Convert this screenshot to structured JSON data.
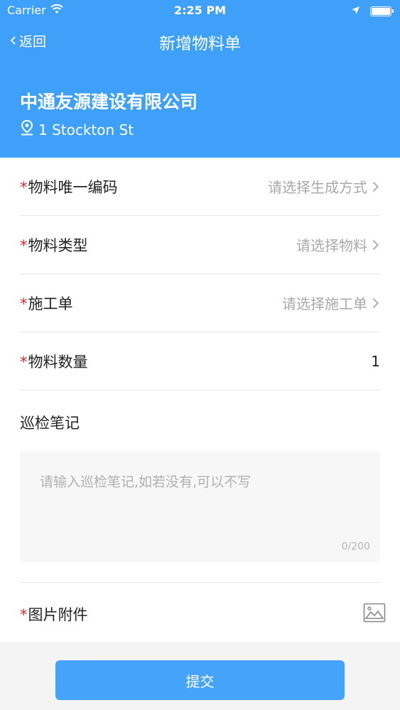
{
  "status_bar": {
    "carrier": "Carrier",
    "time": "2:25 PM"
  },
  "nav": {
    "back_label": "返回",
    "title": "新增物料单"
  },
  "header": {
    "company": "中通友源建设有限公司",
    "address": "1 Stockton St"
  },
  "form": {
    "required_mark": "*",
    "fields": [
      {
        "label": "物料唯一编码",
        "value": "请选择生成方式"
      },
      {
        "label": "物料类型",
        "value": "请选择物料"
      },
      {
        "label": "施工单",
        "value": "请选择施工单"
      },
      {
        "label": "物料数量",
        "value": "1"
      }
    ],
    "notes": {
      "label": "巡检笔记",
      "placeholder": "请输入巡检笔记,如若没有,可以不写",
      "counter": "0/200"
    },
    "attachment": {
      "label": "图片附件"
    }
  },
  "submit": {
    "label": "提交"
  },
  "colors": {
    "primary": "#3fa0f9",
    "required": "#e0242c",
    "placeholder": "#a9a9a9"
  },
  "icons": [
    "wifi-icon",
    "location-arrow-icon",
    "battery-icon",
    "back-chevron-icon",
    "location-pin-icon",
    "chevron-right-icon",
    "image-icon"
  ]
}
